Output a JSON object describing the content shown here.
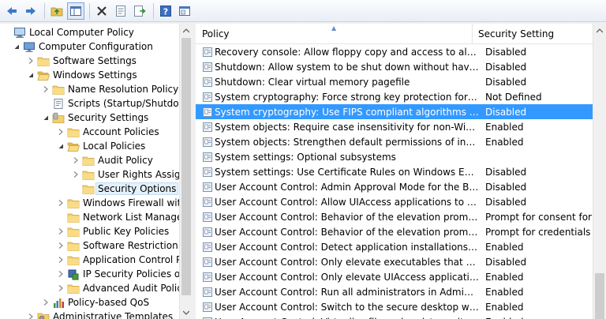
{
  "toolbar": {
    "buttons": [
      "back-icon",
      "forward-icon",
      "up-folder-icon",
      "show-hide-tree-icon",
      "delete-icon",
      "properties-icon",
      "export-list-icon",
      "help-icon",
      "console-view-icon"
    ]
  },
  "tree": {
    "items": [
      {
        "label": "Local Computer Policy"
      },
      {
        "label": "Computer Configuration"
      },
      {
        "label": "Software Settings"
      },
      {
        "label": "Windows Settings"
      },
      {
        "label": "Name Resolution Policy"
      },
      {
        "label": "Scripts (Startup/Shutdown)"
      },
      {
        "label": "Security Settings"
      },
      {
        "label": "Account Policies"
      },
      {
        "label": "Local Policies"
      },
      {
        "label": "Audit Policy"
      },
      {
        "label": "User Rights Assignment"
      },
      {
        "label": "Security Options"
      },
      {
        "label": "Windows Firewall with Advanced Security"
      },
      {
        "label": "Network List Manager Policies"
      },
      {
        "label": "Public Key Policies"
      },
      {
        "label": "Software Restriction Policies"
      },
      {
        "label": "Application Control Policies"
      },
      {
        "label": "IP Security Policies on Local Computer"
      },
      {
        "label": "Advanced Audit Policy Configuration"
      },
      {
        "label": "Policy-based QoS"
      },
      {
        "label": "Administrative Templates"
      }
    ]
  },
  "list": {
    "columns": {
      "policy": "Policy",
      "setting": "Security Setting"
    },
    "rows": [
      {
        "policy": "Recovery console: Allow floppy copy and access to all drives and all folders",
        "setting": "Disabled"
      },
      {
        "policy": "Shutdown: Allow system to be shut down without having to log on",
        "setting": "Disabled"
      },
      {
        "policy": "Shutdown: Clear virtual memory pagefile",
        "setting": "Disabled"
      },
      {
        "policy": "System cryptography: Force strong key protection for user keys stored on the computer",
        "setting": "Not Defined"
      },
      {
        "policy": "System cryptography: Use FIPS compliant algorithms for encryption, hashing, and signing",
        "setting": "Disabled"
      },
      {
        "policy": "System objects: Require case insensitivity for non-Windows subsystems",
        "setting": "Enabled"
      },
      {
        "policy": "System objects: Strengthen default permissions of internal system objects",
        "setting": "Enabled"
      },
      {
        "policy": "System settings: Optional subsystems",
        "setting": ""
      },
      {
        "policy": "System settings: Use Certificate Rules on Windows Executables for Software Restriction Policies",
        "setting": "Disabled"
      },
      {
        "policy": "User Account Control: Admin Approval Mode for the Built-in Administrator account",
        "setting": "Disabled"
      },
      {
        "policy": "User Account Control: Allow UIAccess applications to prompt for elevation",
        "setting": "Disabled"
      },
      {
        "policy": "User Account Control: Behavior of the elevation prompt for administrators",
        "setting": "Prompt for consent for ..."
      },
      {
        "policy": "User Account Control: Behavior of the elevation prompt for standard users",
        "setting": "Prompt for credentials"
      },
      {
        "policy": "User Account Control: Detect application installations and prompt for elevation",
        "setting": "Enabled"
      },
      {
        "policy": "User Account Control: Only elevate executables that are signed and validated",
        "setting": "Disabled"
      },
      {
        "policy": "User Account Control: Only elevate UIAccess applications that are installed in secure locations",
        "setting": "Enabled"
      },
      {
        "policy": "User Account Control: Run all administrators in Admin Approval Mode",
        "setting": "Enabled"
      },
      {
        "policy": "User Account Control: Switch to the secure desktop when prompting for elevation",
        "setting": "Enabled"
      },
      {
        "policy": "User Account Control: Virtualize file and registry write failures to per-user locations",
        "setting": "Enabled"
      }
    ]
  }
}
